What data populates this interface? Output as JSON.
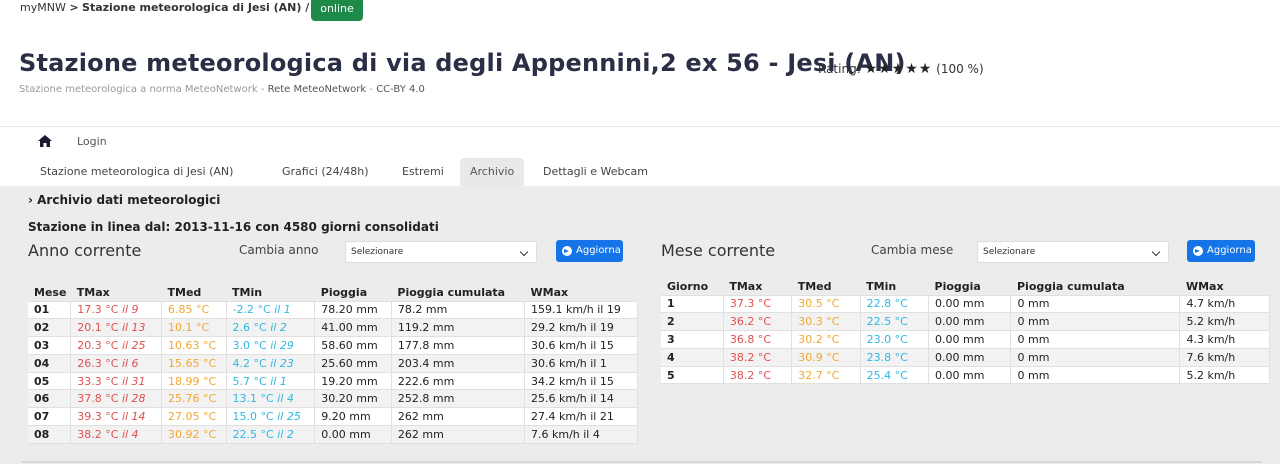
{
  "breadcrumb": {
    "root": "myMNW",
    "separator": ">",
    "current": "Stazione meteorologica di Jesi (AN) /",
    "status": "online"
  },
  "header": {
    "title": "Stazione meteorologica di via degli Appennini,2 ex 56 - Jesi (AN)",
    "rating_label": "Rating:",
    "stars": "★★★★★",
    "rating_value": "(100 %)",
    "subtitle_prefix": "Stazione meteorologica a norma MeteoNetwork - ",
    "subtitle_network": "Rete MeteoNetwork",
    "subtitle_sep": " - ",
    "subtitle_license": "CC-BY 4.0"
  },
  "nav": {
    "login": "Login"
  },
  "tabs": [
    "Stazione meteorologica di Jesi (AN)",
    "Grafici (24/48h)",
    "Estremi",
    "Archivio",
    "Dettagli e Webcam"
  ],
  "archive": {
    "heading": "Archivio dati meteorologici",
    "since": "Stazione in linea dal: 2013-11-16 con 4580 giorni consolidati"
  },
  "anno": {
    "title": "Anno corrente",
    "change_label": "Cambia anno",
    "select_value": "Selezionare",
    "button": "Aggiorna",
    "columns": [
      "Mese",
      "TMax",
      "TMed",
      "TMin",
      "Pioggia",
      "Pioggia cumulata",
      "WMax"
    ],
    "rows": [
      {
        "k": "01",
        "tmax": "17.3 °C",
        "tmax_day": "il 9",
        "tmed": "6.85 °C",
        "tmin": "-2.2 °C",
        "tmin_day": "il 1",
        "rain": "78.20 mm",
        "cum": "78.2 mm",
        "wmax": "159.1 km/h il 19"
      },
      {
        "k": "02",
        "tmax": "20.1 °C",
        "tmax_day": "il 13",
        "tmed": "10.1 °C",
        "tmin": "2.6 °C",
        "tmin_day": "il 2",
        "rain": "41.00 mm",
        "cum": "119.2 mm",
        "wmax": "29.2 km/h il 19"
      },
      {
        "k": "03",
        "tmax": "20.3 °C",
        "tmax_day": "il 25",
        "tmed": "10.63 °C",
        "tmin": "3.0 °C",
        "tmin_day": "il 29",
        "rain": "58.60 mm",
        "cum": "177.8 mm",
        "wmax": "30.6 km/h il 15"
      },
      {
        "k": "04",
        "tmax": "26.3 °C",
        "tmax_day": "il 6",
        "tmed": "15.65 °C",
        "tmin": "4.2 °C",
        "tmin_day": "il 23",
        "rain": "25.60 mm",
        "cum": "203.4 mm",
        "wmax": "30.6 km/h il 1"
      },
      {
        "k": "05",
        "tmax": "33.3 °C",
        "tmax_day": "il 31",
        "tmed": "18.99 °C",
        "tmin": "5.7 °C",
        "tmin_day": "il 1",
        "rain": "19.20 mm",
        "cum": "222.6 mm",
        "wmax": "34.2 km/h il 15"
      },
      {
        "k": "06",
        "tmax": "37.8 °C",
        "tmax_day": "il 28",
        "tmed": "25.76 °C",
        "tmin": "13.1 °C",
        "tmin_day": "il 4",
        "rain": "30.20 mm",
        "cum": "252.8 mm",
        "wmax": "25.6 km/h il 14"
      },
      {
        "k": "07",
        "tmax": "39.3 °C",
        "tmax_day": "il 14",
        "tmed": "27.05 °C",
        "tmin": "15.0 °C",
        "tmin_day": "il 25",
        "rain": "9.20 mm",
        "cum": "262 mm",
        "wmax": "27.4 km/h il 21"
      },
      {
        "k": "08",
        "tmax": "38.2 °C",
        "tmax_day": "il 4",
        "tmed": "30.92 °C",
        "tmin": "22.5 °C",
        "tmin_day": "il 2",
        "rain": "0.00 mm",
        "cum": "262 mm",
        "wmax": "7.6 km/h il 4"
      }
    ]
  },
  "mese": {
    "title": "Mese corrente",
    "change_label": "Cambia mese",
    "select_value": "Selezionare",
    "button": "Aggiorna",
    "columns": [
      "Giorno",
      "TMax",
      "TMed",
      "TMin",
      "Pioggia",
      "Pioggia cumulata",
      "WMax"
    ],
    "rows": [
      {
        "k": "1",
        "tmax": "37.3 °C",
        "tmed": "30.5 °C",
        "tmin": "22.8 °C",
        "rain": "0.00 mm",
        "cum": "0 mm",
        "wmax": "4.7 km/h"
      },
      {
        "k": "2",
        "tmax": "36.2 °C",
        "tmed": "30.3 °C",
        "tmin": "22.5 °C",
        "rain": "0.00 mm",
        "cum": "0 mm",
        "wmax": "5.2 km/h"
      },
      {
        "k": "3",
        "tmax": "36.8 °C",
        "tmed": "30.2 °C",
        "tmin": "23.0 °C",
        "rain": "0.00 mm",
        "cum": "0 mm",
        "wmax": "4.3 km/h"
      },
      {
        "k": "4",
        "tmax": "38.2 °C",
        "tmed": "30.9 °C",
        "tmin": "23.8 °C",
        "rain": "0.00 mm",
        "cum": "0 mm",
        "wmax": "7.6 km/h"
      },
      {
        "k": "5",
        "tmax": "38.2 °C",
        "tmed": "32.7 °C",
        "tmin": "25.4 °C",
        "rain": "0.00 mm",
        "cum": "0 mm",
        "wmax": "5.2 km/h"
      }
    ]
  },
  "colors": {
    "tmax": "#e05050",
    "tmed": "#f0a830",
    "tmin": "#30b8e0",
    "button": "#1574e8",
    "online": "#1e8a4a"
  },
  "icons": {
    "home": "home-icon",
    "chevron": "chevron-right-icon",
    "select": "chevron-down-icon",
    "refresh": "arrow-circle-icon",
    "stars": "star-icon"
  }
}
